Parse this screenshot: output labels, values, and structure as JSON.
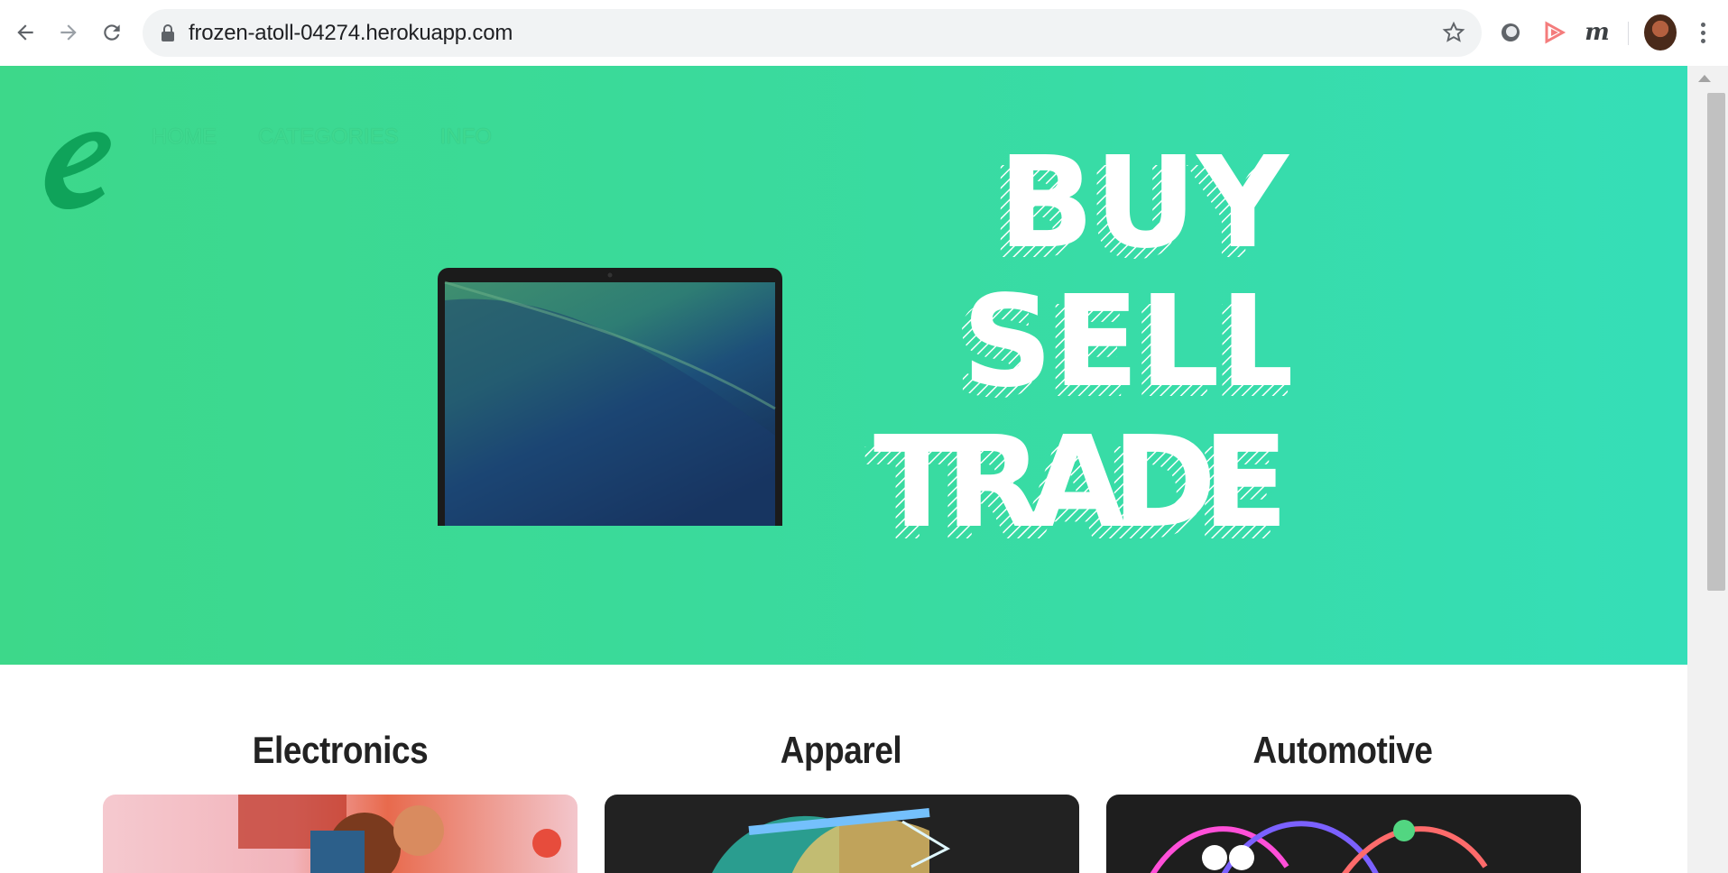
{
  "browser": {
    "url": "frozen-atoll-04274.herokuapp.com",
    "back_icon": "arrow-left-icon",
    "forward_icon": "arrow-right-icon",
    "reload_icon": "reload-icon",
    "bookmark_icon": "star-icon",
    "extensions": [
      "circle-extension-icon",
      "play-extension-icon",
      "m-extension-icon"
    ],
    "m_extension_label": "m"
  },
  "site": {
    "nav": {
      "home": "HOME",
      "categories": "CATEGORIES",
      "info": "INFO"
    },
    "hero": {
      "line1": "BUY",
      "line2": "SELL",
      "line3": "TRADE",
      "colors": {
        "gradient_start": "#3dd88a",
        "gradient_end": "#35deb8",
        "logo": "#0fa35a"
      }
    },
    "categories": [
      {
        "title": "Electronics"
      },
      {
        "title": "Apparel"
      },
      {
        "title": "Automotive"
      }
    ]
  }
}
